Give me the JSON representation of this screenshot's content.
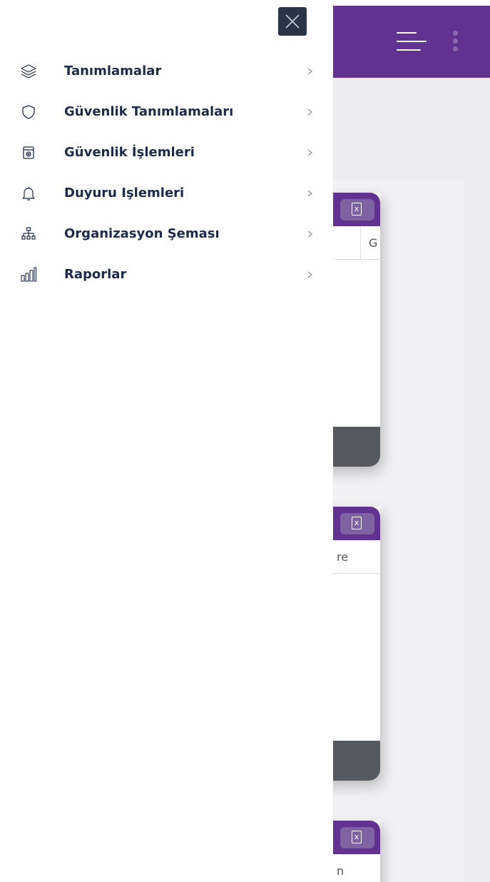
{
  "background": {
    "topbar_color": "#623290",
    "cards": [
      {
        "column_text": "G"
      },
      {
        "column_text": "re"
      },
      {
        "column_text": "n"
      }
    ],
    "excel_icon": "excel-file-icon"
  },
  "drawer": {
    "close_icon": "close-icon",
    "items": [
      {
        "label": "Tanımlamalar",
        "icon": "layers-icon"
      },
      {
        "label": "Güvenlik Tanımlamaları",
        "icon": "shield-icon"
      },
      {
        "label": "Güvenlik İşlemleri",
        "icon": "safe-icon"
      },
      {
        "label": "Duyuru Işlemleri",
        "icon": "bell-icon"
      },
      {
        "label": "Organizasyon Şeması",
        "icon": "org-chart-icon"
      },
      {
        "label": "Raporlar",
        "icon": "bar-chart-icon"
      }
    ]
  },
  "colors": {
    "accent": "#623290",
    "menu_text": "#1e2a4a",
    "close_button": "#2b3346",
    "card_footer": "#56595e"
  }
}
